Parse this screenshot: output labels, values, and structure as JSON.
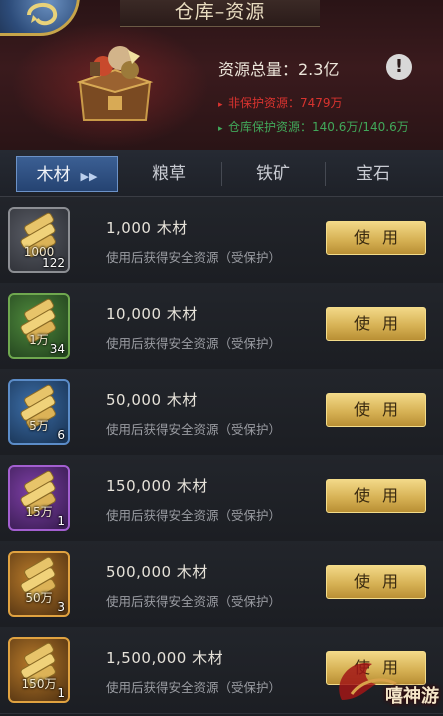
{
  "header": {
    "title": "仓库–资源",
    "total_label": "资源总量：2.3亿",
    "unprotected_label": "非保护资源：7479万",
    "protected_label": "仓库保护资源：140.6万/140.6万",
    "info_symbol": "!"
  },
  "tabs": [
    {
      "label": "木材",
      "active": true
    },
    {
      "label": "粮草",
      "active": false
    },
    {
      "label": "铁矿",
      "active": false
    },
    {
      "label": "宝石",
      "active": false
    }
  ],
  "items": [
    {
      "name": "1,000  木材",
      "desc": "使用后获得安全资源（受保护）",
      "icon_amount": "1000",
      "count": "122",
      "button": "使用",
      "rarity": "gray"
    },
    {
      "name": "10,000  木材",
      "desc": "使用后获得安全资源（受保护）",
      "icon_amount": "1万",
      "count": "34",
      "button": "使用",
      "rarity": "green"
    },
    {
      "name": "50,000  木材",
      "desc": "使用后获得安全资源（受保护）",
      "icon_amount": "5万",
      "count": "6",
      "button": "使用",
      "rarity": "blue"
    },
    {
      "name": "150,000  木材",
      "desc": "使用后获得安全资源（受保护）",
      "icon_amount": "15万",
      "count": "1",
      "button": "使用",
      "rarity": "purple"
    },
    {
      "name": "500,000  木材",
      "desc": "使用后获得安全资源（受保护）",
      "icon_amount": "50万",
      "count": "3",
      "button": "使用",
      "rarity": "orange"
    },
    {
      "name": "1,500,000  木材",
      "desc": "使用后获得安全资源（受保护）",
      "icon_amount": "150万",
      "count": "1",
      "button": "使用",
      "rarity": "orange"
    }
  ],
  "watermark": "嘻神游",
  "colors": {
    "unprotected": "#d8332f",
    "protected": "#41a85a",
    "button_gold": "#d7b255",
    "tab_active": "#2f5283"
  }
}
